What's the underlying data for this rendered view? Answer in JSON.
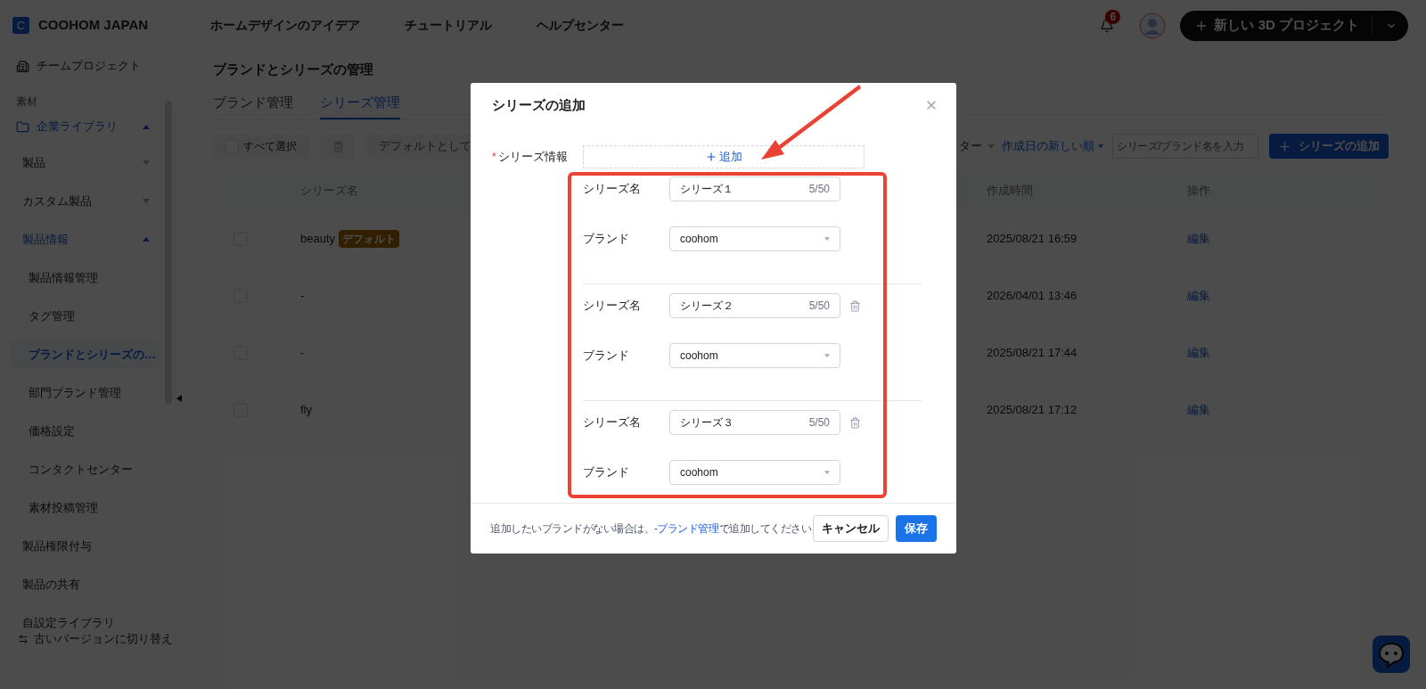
{
  "header": {
    "logo_letter": "C",
    "brand": "COOHOM JAPAN",
    "nav": [
      "ホームデザインのアイデア",
      "チュートリアル",
      "ヘルプセンター"
    ],
    "notification_count": "6",
    "new_project_button": "新しい 3D プロジェクト"
  },
  "sidebar": {
    "team_project": "チームプロジェクト",
    "section_label": "素材",
    "library": {
      "label": "企業ライブラリ",
      "expanded": true
    },
    "items": [
      {
        "kind": "group",
        "label": "製品",
        "expanded": false
      },
      {
        "kind": "group",
        "label": "カスタム製品",
        "expanded": false
      },
      {
        "kind": "group",
        "label": "製品情報",
        "expanded": true,
        "children": [
          {
            "label": "製品情報管理",
            "selected": false
          },
          {
            "label": "タグ管理",
            "selected": false
          },
          {
            "label": "ブランドとシリーズの…",
            "selected": true
          },
          {
            "label": "部門ブランド管理",
            "selected": false
          },
          {
            "label": "価格設定",
            "selected": false
          },
          {
            "label": "コンタクトセンター",
            "selected": false
          },
          {
            "label": "素材投稿管理",
            "selected": false
          }
        ]
      },
      {
        "kind": "link",
        "label": "製品権限付与"
      },
      {
        "kind": "link",
        "label": "製品の共有"
      },
      {
        "kind": "link",
        "label": "自設定ライブラリ"
      }
    ],
    "footer_link": "古いバージョンに切り替え"
  },
  "page": {
    "title": "ブランドとシリーズの管理",
    "tabs": [
      {
        "label": "ブランド管理",
        "selected": false
      },
      {
        "label": "シリーズ管理",
        "selected": true
      }
    ],
    "toolbar": {
      "select_all": {
        "label": "すべて選択",
        "checked": false
      },
      "set_default_button": "デフォルトとして",
      "filter": "ター",
      "sort": "作成日の新しい順",
      "search_placeholder": "シリーズ/ブランド名を入力",
      "add_button": "シリーズの追加"
    },
    "table": {
      "columns": [
        "シリーズ名",
        "作成時間",
        "操作"
      ],
      "rows": [
        {
          "checked": false,
          "name": "beauty",
          "tag": "デフォルト",
          "created": "2025/08/21 16:59",
          "action": "編集"
        },
        {
          "checked": false,
          "name": "-",
          "created": "2026/04/01 13:46",
          "action": "編集"
        },
        {
          "checked": false,
          "name": "-",
          "created": "2025/08/21 17:44",
          "action": "編集"
        },
        {
          "checked": false,
          "name": "fly",
          "created": "2025/08/21 17:12",
          "action": "編集"
        }
      ]
    }
  },
  "dialog": {
    "title": "シリーズの追加",
    "field_label": "シリーズ情報",
    "required_mark": "*",
    "add_button": "追加",
    "entries": [
      {
        "name_label": "シリーズ名",
        "name_value": "シリーズ１",
        "counter": "5/50",
        "brand_label": "ブランド",
        "brand_value": "coohom",
        "removable": false
      },
      {
        "name_label": "シリーズ名",
        "name_value": "シリーズ２",
        "counter": "5/50",
        "brand_label": "ブランド",
        "brand_value": "coohom",
        "removable": true
      },
      {
        "name_label": "シリーズ名",
        "name_value": "シリーズ３",
        "counter": "5/50",
        "brand_label": "ブランド",
        "brand_value": "coohom",
        "removable": true
      }
    ],
    "hint_before": "追加したいブランドがない場合は、",
    "hint_link": "-ブランド管理",
    "hint_after": "で追加してください",
    "cancel_button": "キャンセル",
    "save_button": "保存"
  }
}
